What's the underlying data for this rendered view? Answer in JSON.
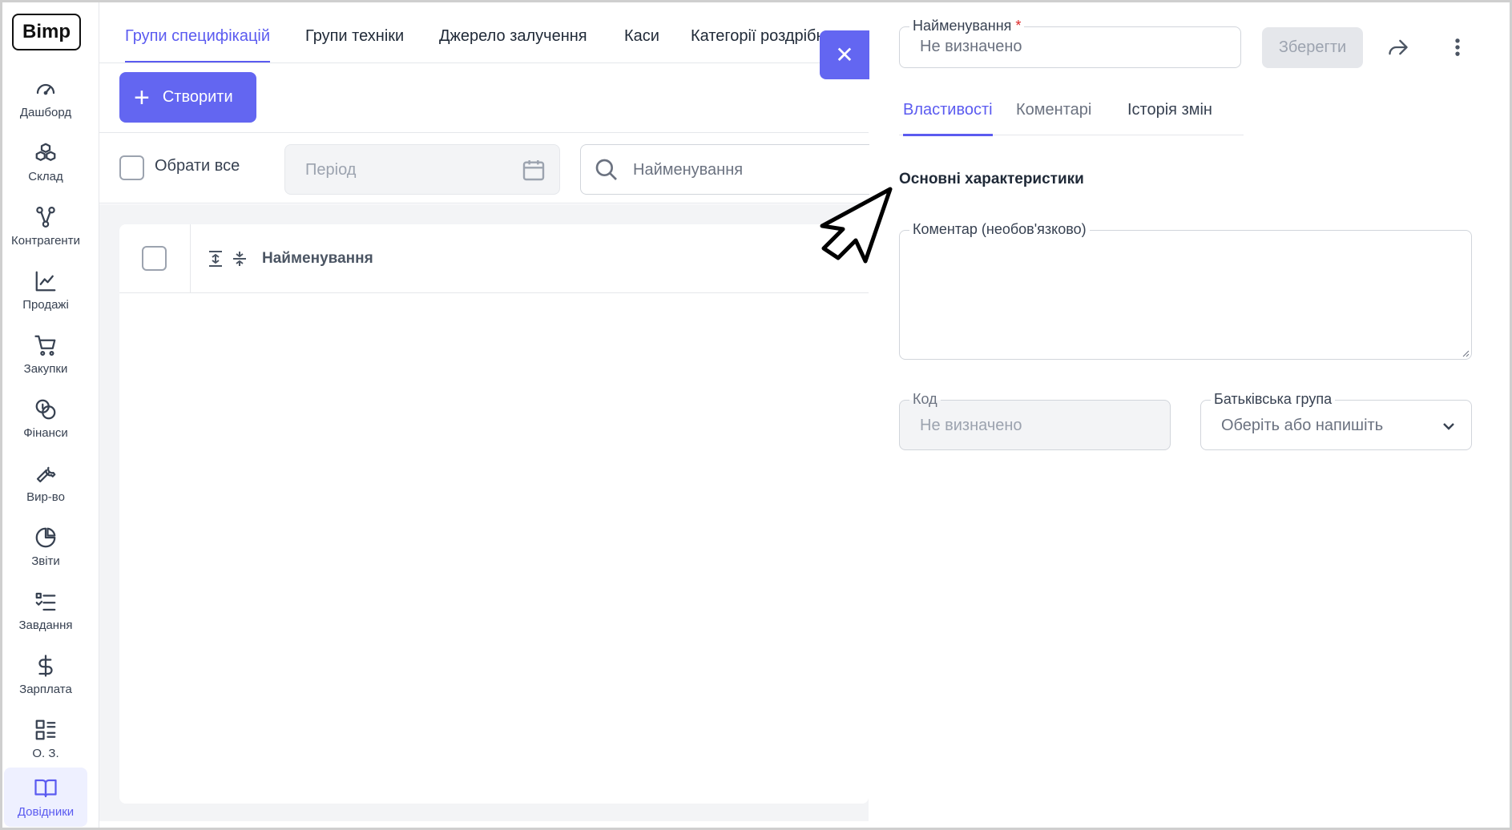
{
  "app": {
    "logo_text": "Bimp"
  },
  "sidebar": {
    "items": [
      {
        "label": "Дашборд",
        "icon": "gauge-icon"
      },
      {
        "label": "Склад",
        "icon": "boxes-icon"
      },
      {
        "label": "Контрагенти",
        "icon": "network-icon"
      },
      {
        "label": "Продажі",
        "icon": "line-chart-icon"
      },
      {
        "label": "Закупки",
        "icon": "cart-icon"
      },
      {
        "label": "Фінанси",
        "icon": "coins-icon"
      },
      {
        "label": "Вир-во",
        "icon": "wrench-icon"
      },
      {
        "label": "Звіти",
        "icon": "pie-chart-icon"
      },
      {
        "label": "Завдання",
        "icon": "task-list-icon"
      },
      {
        "label": "Зарплата",
        "icon": "dollar-icon"
      },
      {
        "label": "О. З.",
        "icon": "assets-list-icon"
      },
      {
        "label": "Довідники",
        "icon": "book-icon",
        "active": true
      }
    ]
  },
  "top_tabs": [
    {
      "label": "Групи специфікацій",
      "active": true
    },
    {
      "label": "Групи техніки"
    },
    {
      "label": "Джерело залучення"
    },
    {
      "label": "Каси"
    },
    {
      "label": "Категорії роздрібних"
    }
  ],
  "toolbar": {
    "create_label": "Створити"
  },
  "filters": {
    "select_all_label": "Обрати все",
    "period_placeholder": "Період",
    "search_placeholder": "Найменування"
  },
  "table": {
    "columns": [
      "Найменування"
    ]
  },
  "drawer": {
    "name_field": {
      "label": "Найменування",
      "required_mark": "*",
      "placeholder": "Не визначено"
    },
    "save_label": "Зберегти",
    "tabs": [
      {
        "label": "Властивості",
        "active": true
      },
      {
        "label": "Коментарі"
      },
      {
        "label": "Історія змін"
      }
    ],
    "section_title": "Основні характеристики",
    "comment_field": {
      "label": "Коментар (необов'язково)",
      "value": ""
    },
    "code_field": {
      "label": "Код",
      "placeholder": "Не визначено"
    },
    "parent_group_field": {
      "label": "Батьківська група",
      "placeholder": "Оберіть або напишіть"
    }
  },
  "colors": {
    "accent": "#6366f1",
    "accent_text": "#5b5bf0",
    "required": "#dc2626"
  }
}
